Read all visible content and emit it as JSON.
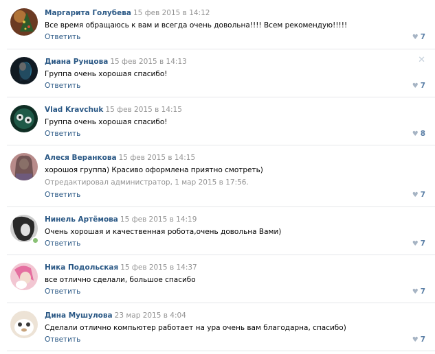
{
  "comments": [
    {
      "author": "Маргарита Голубева",
      "date": "15 фев 2015 в 14:12",
      "text": "Все время обращаюсь к вам и всегда очень довольна!!!! Всем рекомендую!!!!!",
      "reply": "Ответить",
      "likes": "7",
      "avatar": "avatar-photo"
    },
    {
      "author": "Диана Рунцова",
      "date": "15 фев 2015 в 14:13",
      "text": "Группа очень хорошая спасибо!",
      "reply": "Ответить",
      "likes": "7",
      "avatar": "avatar-photo"
    },
    {
      "author": "Vlad Kravchuk",
      "date": "15 фев 2015 в 14:15",
      "text": "Группа очень хорошая спасибо!",
      "reply": "Ответить",
      "likes": "8",
      "avatar": "avatar-photo"
    },
    {
      "author": "Алеся Веранкова",
      "date": "15 фев 2015 в 14:15",
      "text": "хорошоя группа) Красиво оформлена приятно смотреть)",
      "edited": "Отредактировал администратор, 1 мар 2015 в 17:56.",
      "reply": "Ответить",
      "likes": "7",
      "avatar": "avatar-photo"
    },
    {
      "author": "Нинель Артёмова",
      "date": "15 фев 2015 в 14:19",
      "text": "Очень хорошая и качественная робота,очень довольна Вами)",
      "reply": "Ответить",
      "likes": "7",
      "avatar": "avatar-photo",
      "online": true
    },
    {
      "author": "Ника Подольская",
      "date": "15 фев 2015 в 14:37",
      "text": "все отлично сделали, большое спасибо",
      "reply": "Ответить",
      "likes": "7",
      "avatar": "avatar-photo"
    },
    {
      "author": "Дина Мушулова",
      "date": "23 мар 2015 в 4:04",
      "text": "Сделали отлично компьютер работает на ура очень вам благодарна, спасибо)",
      "reply": "Ответить",
      "likes": "7",
      "avatar": "avatar-photo"
    }
  ],
  "icons": {
    "like": "heart-icon",
    "delete": "close-icon"
  },
  "colors": {
    "author": "#2a5885",
    "date": "#939393",
    "like": "#5b7fa6",
    "separator": "#e4e6e9",
    "online": "#8ac176"
  }
}
